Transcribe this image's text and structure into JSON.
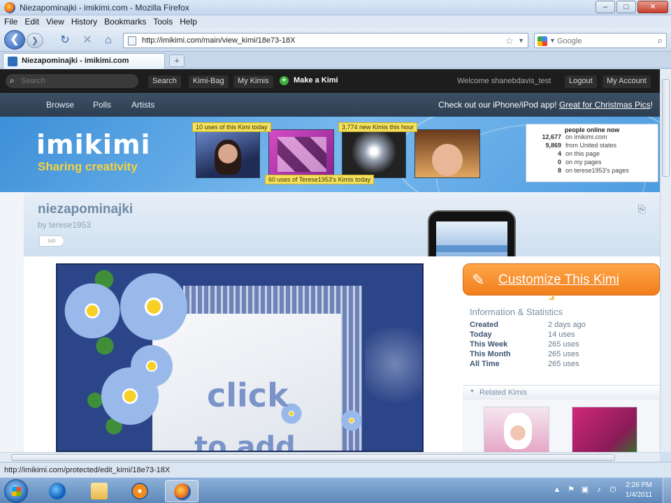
{
  "window": {
    "title": "Niezapominajki - imikimi.com - Mozilla Firefox",
    "min": "–",
    "max": "□",
    "close": "✕"
  },
  "menu": [
    "File",
    "Edit",
    "View",
    "History",
    "Bookmarks",
    "Tools",
    "Help"
  ],
  "toolbar": {
    "back": "❮",
    "forward": "❯",
    "reload": "↻",
    "stop": "✕",
    "home": "⌂",
    "url": "http://imikimi.com/main/view_kimi/18e73-18X",
    "search_placeholder": "Google"
  },
  "tabs": [
    {
      "label": "Niezapominajki - imikimi.com"
    }
  ],
  "new_tab": "+",
  "site": {
    "search_placeholder": "Search",
    "search_button": "Search",
    "kimi_bag": "Kimi-Bag",
    "my_kimis": "My Kimis",
    "make_kimi": "Make a Kimi",
    "welcome": "Welcome shanebdavis_test",
    "logout": "Logout",
    "my_account": "My Account",
    "nav": [
      "Browse",
      "Polls",
      "Artists"
    ],
    "promo_text": "Check out our iPhone/iPod app! ",
    "promo_link": "Great for Christmas Pics",
    "promo_end": "!"
  },
  "banner": {
    "logo": "imikimi",
    "tagline": "Sharing creativity",
    "ribbon_1": "10 uses of this Kimi today",
    "ribbon_2": "3,774 new Kimis this hour",
    "ribbon_3": "60 uses of Terese1953's Kimis today",
    "online_head": "people online now",
    "online_rows": [
      {
        "num": "12,677",
        "label": "on imikimi.com"
      },
      {
        "num": "9,869",
        "label": "from United states"
      },
      {
        "num": "4",
        "label": "on this page"
      },
      {
        "num": "0",
        "label": "on my pages"
      },
      {
        "num": "8",
        "label": "on terese1953's pages"
      }
    ]
  },
  "kimi": {
    "title": "niezapominajki",
    "by": "by terese1953",
    "tag": "tab",
    "share_icon": "⎘",
    "canvas_click": "click",
    "canvas_add": "to add"
  },
  "sidebar": {
    "customize": "Customize This Kimi",
    "pencil": "✎",
    "cursor": "☝",
    "info_title": "Information & Statistics",
    "info_rows": [
      {
        "k": "Created",
        "v": "2 days ago"
      },
      {
        "k": "Today",
        "v": "14 uses"
      },
      {
        "k": "This Week",
        "v": "265 uses"
      },
      {
        "k": "This Month",
        "v": "265 uses"
      },
      {
        "k": "All Time",
        "v": "265 uses"
      }
    ],
    "related_title": "Related Kimis"
  },
  "status": {
    "text": "http://imikimi.com/protected/edit_kimi/18e73-18X"
  },
  "taskbar": {
    "clock_time": "2:26 PM",
    "clock_date": "1/4/2011",
    "tray": [
      "▲",
      "⚑",
      "▣",
      "♪",
      "⏻"
    ]
  }
}
